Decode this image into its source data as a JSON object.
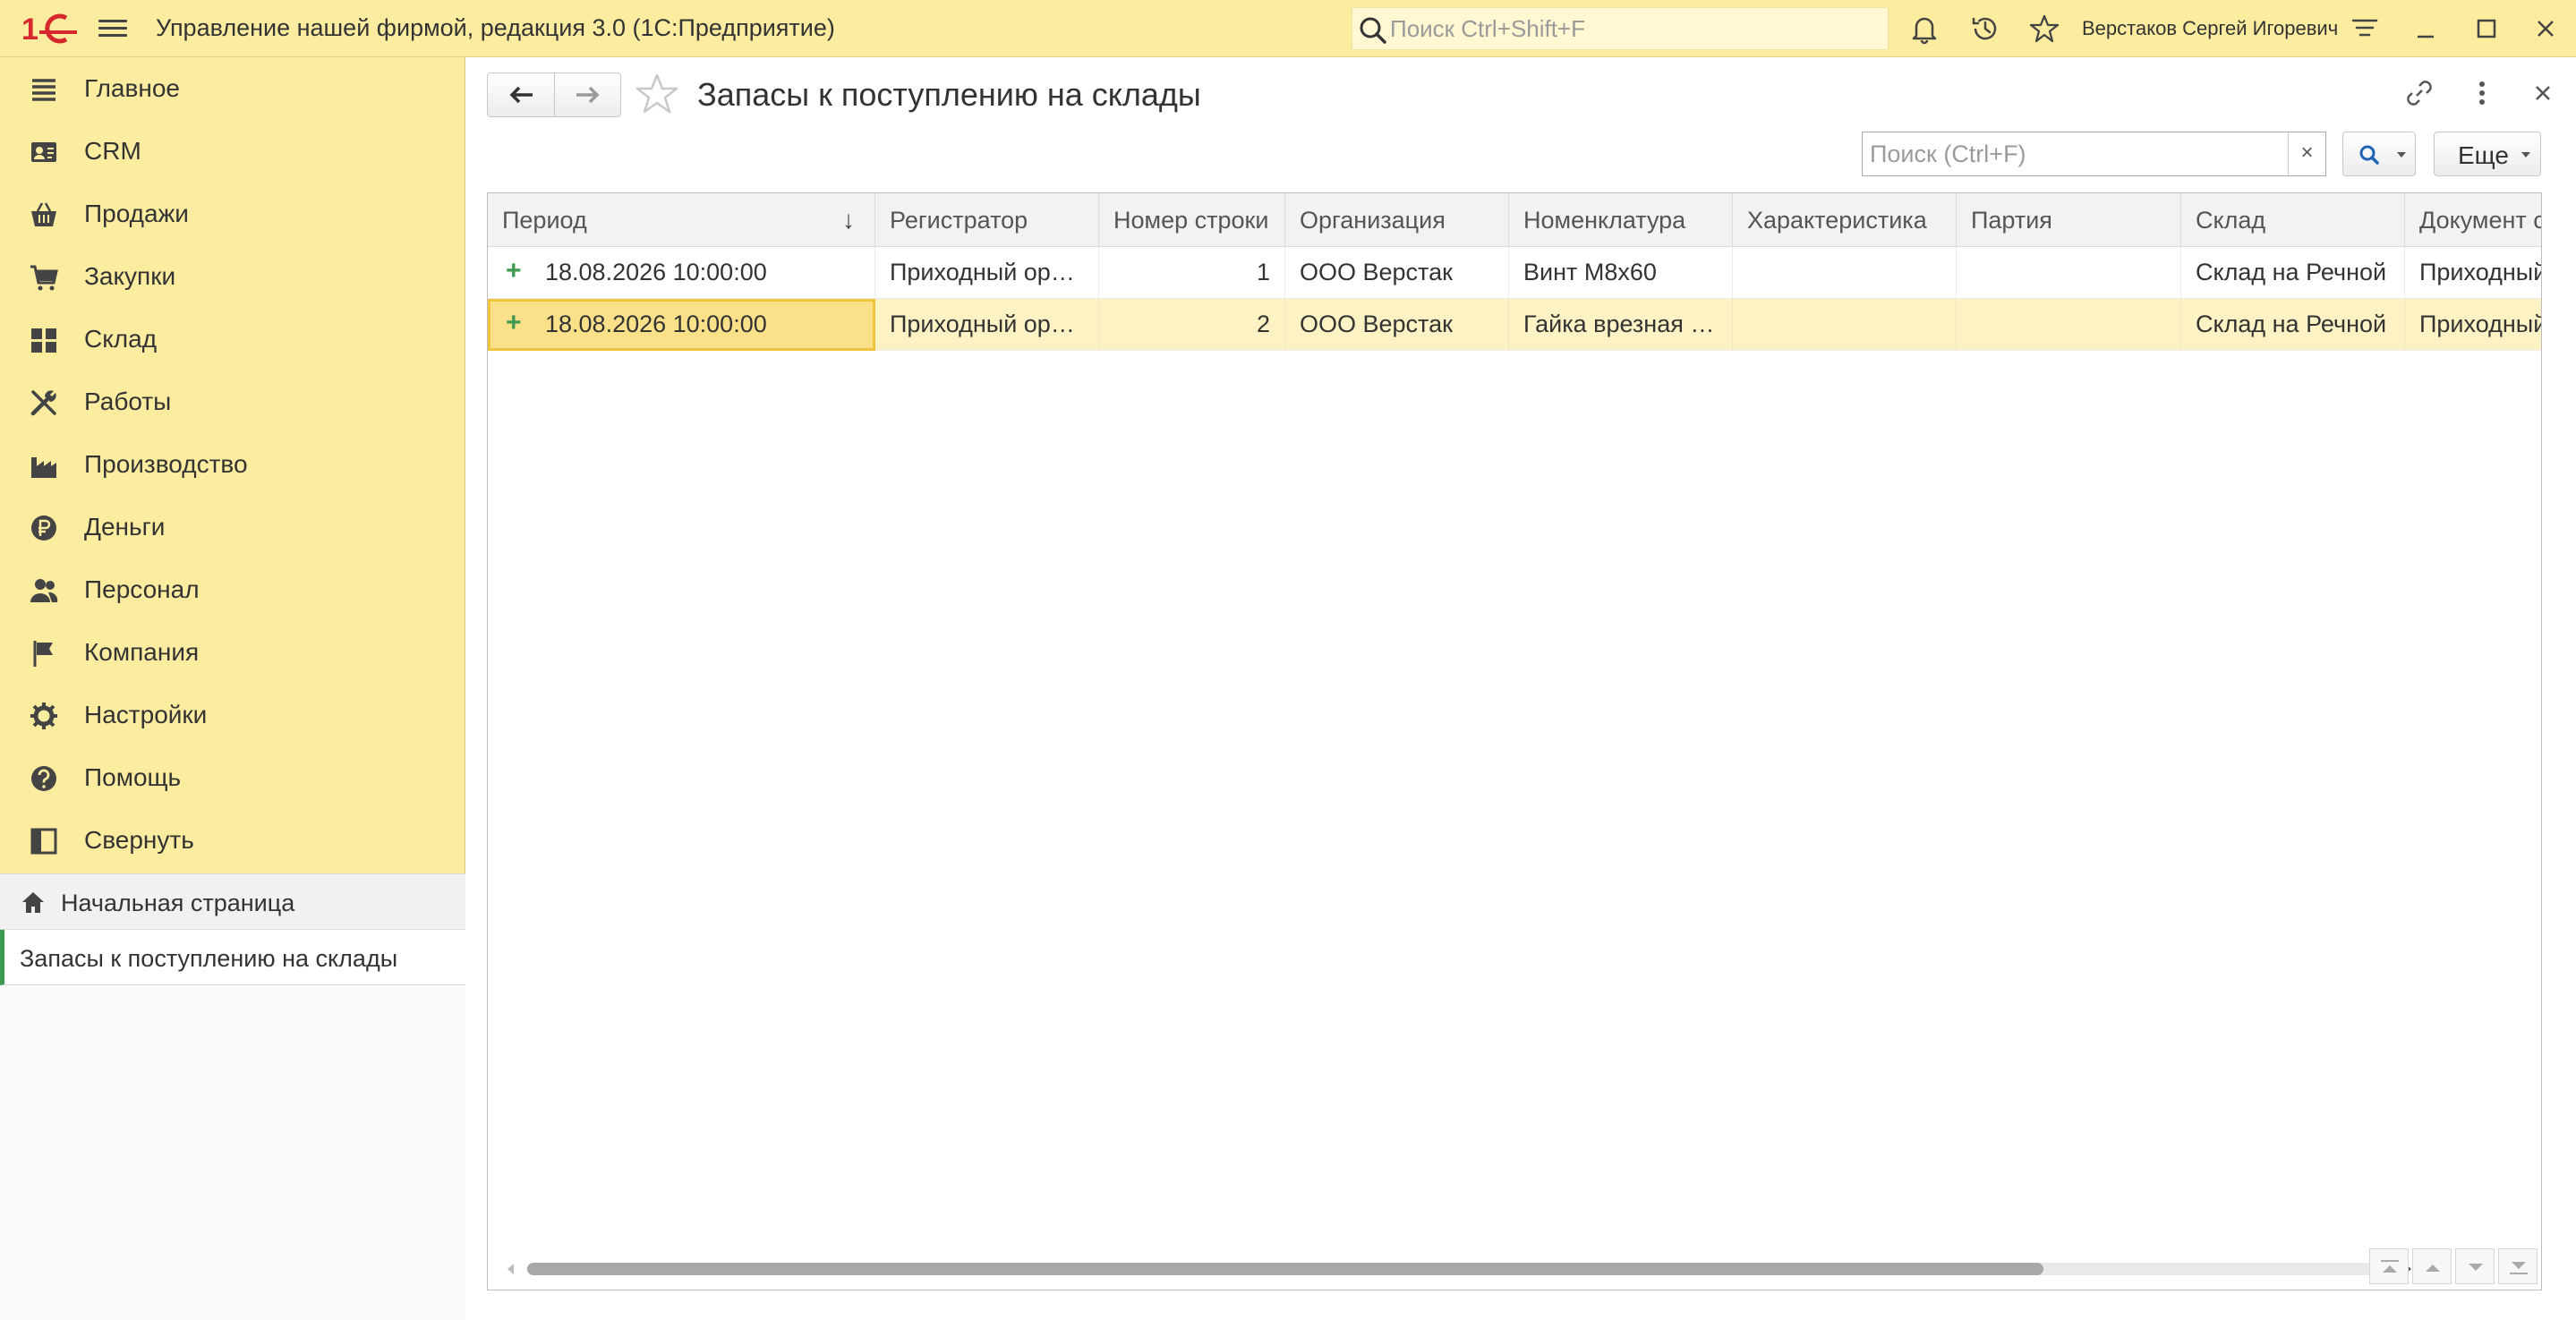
{
  "titlebar": {
    "app_title": "Управление нашей фирмой, редакция 3.0  (1С:Предприятие)",
    "search_placeholder": "Поиск Ctrl+Shift+F",
    "user_name": "Верстаков Сергей Игоревич"
  },
  "sidebar": {
    "items": [
      {
        "label": "Главное",
        "icon": "list-icon"
      },
      {
        "label": "CRM",
        "icon": "contact-card-icon"
      },
      {
        "label": "Продажи",
        "icon": "basket-icon"
      },
      {
        "label": "Закупки",
        "icon": "cart-icon"
      },
      {
        "label": "Склад",
        "icon": "warehouse-grid-icon"
      },
      {
        "label": "Работы",
        "icon": "tools-icon"
      },
      {
        "label": "Производство",
        "icon": "factory-icon"
      },
      {
        "label": "Деньги",
        "icon": "ruble-coin-icon"
      },
      {
        "label": "Персонал",
        "icon": "people-icon"
      },
      {
        "label": "Компания",
        "icon": "flag-icon"
      },
      {
        "label": "Настройки",
        "icon": "gear-icon"
      },
      {
        "label": "Помощь",
        "icon": "help-icon"
      },
      {
        "label": "Свернуть",
        "icon": "collapse-panel-icon"
      }
    ],
    "open_windows": {
      "home": "Начальная страница",
      "current": "Запасы к поступлению на склады"
    }
  },
  "form": {
    "title": "Запасы к поступлению на склады",
    "search_placeholder": "Поиск (Ctrl+F)",
    "clear_label": "×",
    "more_label": "Еще"
  },
  "table": {
    "columns": [
      "Период",
      "Регистратор",
      "Номер строки",
      "Организация",
      "Номенклатура",
      "Характеристика",
      "Партия",
      "Склад",
      "Документ с"
    ],
    "sort_indicator": "↓",
    "rows": [
      {
        "mark": "+",
        "period": "18.08.2026 10:00:00",
        "registrator": "Приходный ор…",
        "line_no": "1",
        "organization": "ООО Верстак",
        "nomenclature": "Винт М8х60",
        "characteristic": "",
        "batch": "",
        "warehouse": "Склад на Речной",
        "document": "Приходный"
      },
      {
        "mark": "+",
        "period": "18.08.2026 10:00:00",
        "registrator": "Приходный ор…",
        "line_no": "2",
        "organization": "ООО Верстак",
        "nomenclature": "Гайка врезная …",
        "characteristic": "",
        "batch": "",
        "warehouse": "Склад на Речной",
        "document": "Приходный"
      }
    ],
    "selected_row": 1
  },
  "colors": {
    "accent_yellow": "#fbec9f",
    "selection": "#fdf2c4",
    "focus_cell": "#fbe08a",
    "green_mark": "#3d9a4f",
    "logo_red": "#d6262e"
  }
}
